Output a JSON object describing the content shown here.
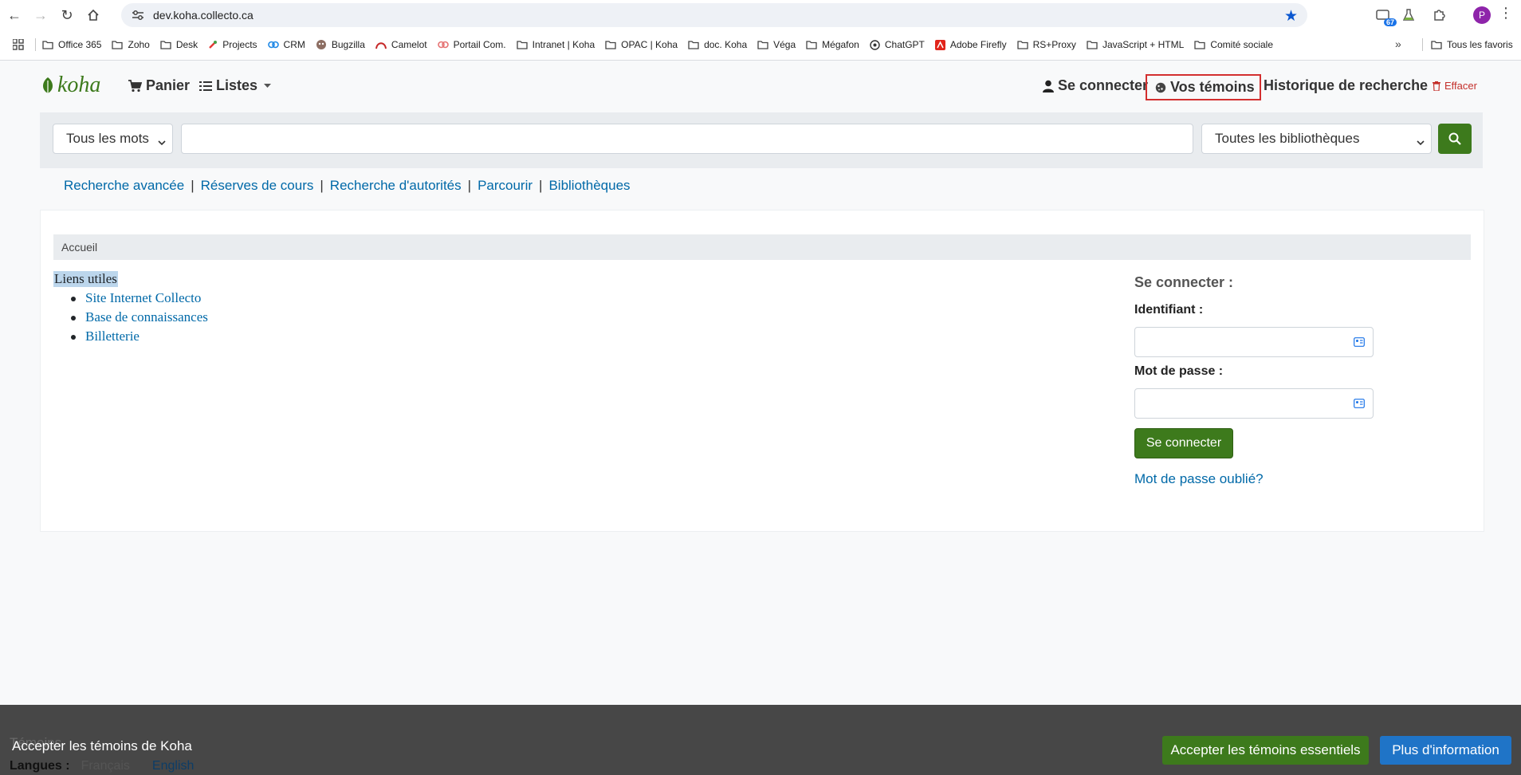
{
  "browser": {
    "url": "dev.koha.collecto.ca",
    "extension_badge": "67",
    "profile_initial": "P",
    "bookmarks": [
      {
        "label": "Office 365",
        "icon": "folder-icon"
      },
      {
        "label": "Zoho",
        "icon": "folder-icon"
      },
      {
        "label": "Desk",
        "icon": "folder-icon"
      },
      {
        "label": "Projects",
        "icon": "rocket-icon"
      },
      {
        "label": "CRM",
        "icon": "crm-icon"
      },
      {
        "label": "Bugzilla",
        "icon": "bug-icon"
      },
      {
        "label": "Camelot",
        "icon": "camelot-icon"
      },
      {
        "label": "Portail Com.",
        "icon": "portal-icon"
      },
      {
        "label": "Intranet | Koha",
        "icon": "folder-icon"
      },
      {
        "label": "OPAC | Koha",
        "icon": "folder-icon"
      },
      {
        "label": "doc. Koha",
        "icon": "folder-icon"
      },
      {
        "label": "Véga",
        "icon": "folder-icon"
      },
      {
        "label": "Mégafon",
        "icon": "folder-icon"
      },
      {
        "label": "ChatGPT",
        "icon": "chatgpt-icon"
      },
      {
        "label": "Adobe Firefly",
        "icon": "adobe-icon"
      },
      {
        "label": "RS+Proxy",
        "icon": "folder-icon"
      },
      {
        "label": "JavaScript + HTML",
        "icon": "folder-icon"
      },
      {
        "label": "Comité sociale",
        "icon": "folder-icon"
      }
    ],
    "all_bookmarks": "Tous les favoris"
  },
  "header": {
    "logo": "koha",
    "cart": "Panier",
    "lists": "Listes",
    "login": "Se connecter",
    "cookies": "Vos témoins",
    "history": "Historique de recherche",
    "clear": "Effacer"
  },
  "search": {
    "type": "Tous les mots",
    "query": "",
    "library": "Toutes les bibliothèques"
  },
  "moresearches": [
    "Recherche avancée",
    "Réserves de cours",
    "Recherche d'autorités",
    "Parcourir",
    "Bibliothèques"
  ],
  "breadcrumb": "Accueil",
  "useful_links": {
    "title": "Liens utiles",
    "items": [
      "Site Internet Collecto",
      "Base de connaissances",
      "Billetterie"
    ]
  },
  "login_box": {
    "heading": "Se connecter :",
    "username_label": "Identifiant :",
    "username_value": "",
    "password_label": "Mot de passe :",
    "password_value": "",
    "submit": "Se connecter",
    "forgot": "Mot de passe oublié?"
  },
  "cookie_banner": {
    "text": "Accepter les témoins de Koha",
    "behind_text": "Témoins",
    "accept_essential": "Accepter les témoins essentiels",
    "more_info": "Plus d'information"
  },
  "languages": {
    "label": "Langues :",
    "current": "Français",
    "other": "English"
  },
  "colors": {
    "koha_green": "#3d7a1c",
    "link_blue": "#0069a8",
    "highlight_red": "#d32f2f",
    "info_blue": "#1f74c7"
  }
}
